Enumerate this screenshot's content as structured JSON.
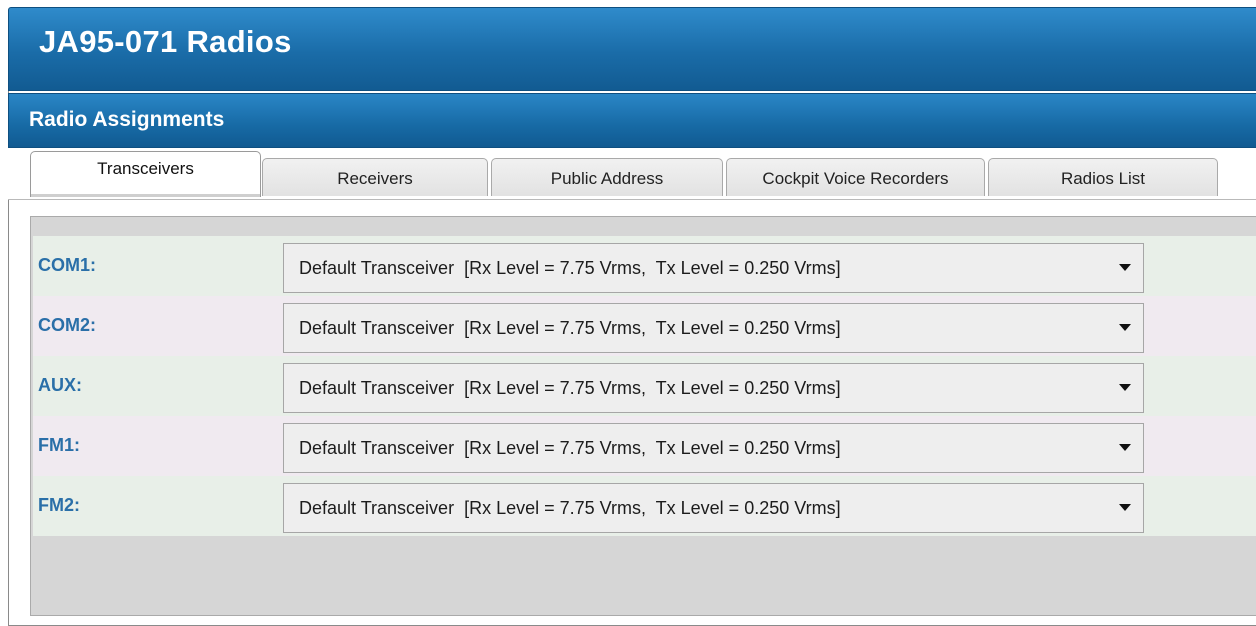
{
  "window": {
    "title": "JA95-071 Radios",
    "subtitle": "Radio Assignments"
  },
  "tabs": [
    {
      "label": "Transceivers",
      "active": true
    },
    {
      "label": "Receivers",
      "active": false
    },
    {
      "label": "Public Address",
      "active": false
    },
    {
      "label": "Cockpit Voice Recorders",
      "active": false
    },
    {
      "label": "Radios List",
      "active": false
    }
  ],
  "assignments": [
    {
      "label": "COM1:",
      "value": "Default Transceiver  [Rx Level = 7.75 Vrms,  Tx Level = 0.250 Vrms]"
    },
    {
      "label": "COM2:",
      "value": "Default Transceiver  [Rx Level = 7.75 Vrms,  Tx Level = 0.250 Vrms]"
    },
    {
      "label": "AUX:",
      "value": "Default Transceiver  [Rx Level = 7.75 Vrms,  Tx Level = 0.250 Vrms]"
    },
    {
      "label": "FM1:",
      "value": "Default Transceiver  [Rx Level = 7.75 Vrms,  Tx Level = 0.250 Vrms]"
    },
    {
      "label": "FM2:",
      "value": "Default Transceiver  [Rx Level = 7.75 Vrms,  Tx Level = 0.250 Vrms]"
    }
  ],
  "colors": {
    "header_blue": "#1a6ca8",
    "label_blue": "#2a6fa8",
    "row_green": "#e8efe8",
    "row_pink": "#f0eaf0"
  },
  "icons": {
    "dropdown": "chevron-down-icon"
  }
}
